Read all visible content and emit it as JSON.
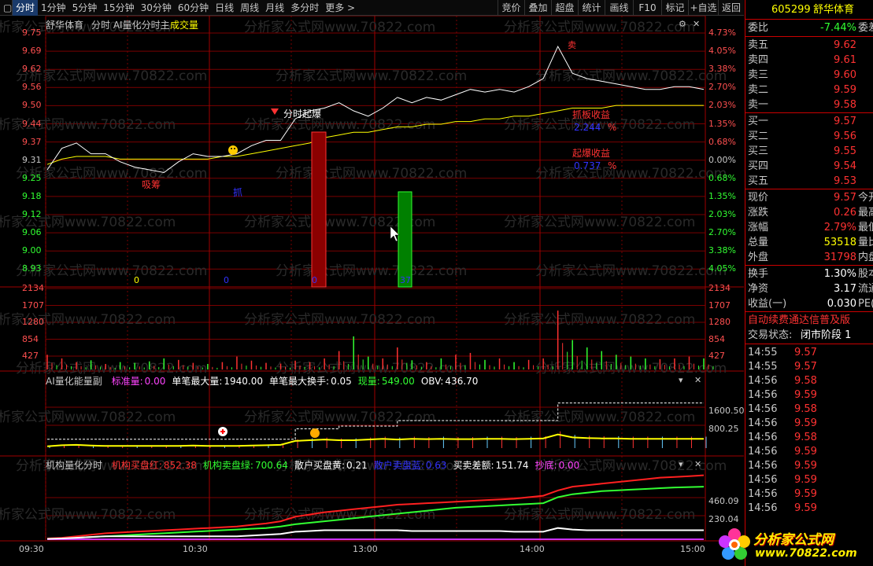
{
  "toolbar": {
    "tabs": [
      "分时",
      "1分钟",
      "5分钟",
      "15分钟",
      "30分钟",
      "60分钟",
      "日线",
      "周线",
      "月线",
      "多分时",
      "更多 >"
    ],
    "right_buttons": [
      "竞价",
      "叠加",
      "超盘",
      "统计",
      "画线",
      "F10",
      "标记",
      "+自选",
      "返回"
    ]
  },
  "main_panel": {
    "title": "舒华体育",
    "subtitle": "分时 AI量化分时主",
    "subtitle2": "成交量",
    "y_left": [
      "9.75",
      "9.69",
      "9.62",
      "9.56",
      "9.50",
      "9.44",
      "9.37",
      "9.31",
      "9.25",
      "9.18",
      "9.12",
      "9.06",
      "9.00",
      "8.93"
    ],
    "y_right": [
      "4.73%",
      "4.05%",
      "3.38%",
      "2.70%",
      "2.03%",
      "1.35%",
      "0.68%",
      "0.00%",
      "0.68%",
      "1.35%",
      "2.03%",
      "2.70%",
      "3.38%",
      "4.05%"
    ],
    "annotations": {
      "xichou": "吸筹",
      "dip": "抓",
      "fenshiqibao": "分时起爆",
      "zhaban_label": "抓板收益",
      "zhaban_value": "2.244",
      "qibao_label": "起爆收益",
      "qibao_value": "0.737",
      "pct": "%",
      "top_mark": "卖",
      "zero_a": "0",
      "zero_b": "0",
      "bar_label_a": "0",
      "bar_label_b": "37"
    }
  },
  "volume_panel": {
    "y": [
      "2134",
      "1707",
      "1280",
      "854",
      "427"
    ]
  },
  "ai_panel": {
    "title": "AI量化能量副",
    "items": [
      {
        "label": "标准量:",
        "value": "0.00",
        "color": "#ff44ff"
      },
      {
        "label": "单笔最大量:",
        "value": "1940.00",
        "color": "#ffffff"
      },
      {
        "label": "单笔最大换手:",
        "value": "0.05",
        "color": "#ffffff"
      },
      {
        "label": "现量:",
        "value": "549.00",
        "color": "#32ff32"
      },
      {
        "label": "OBV:",
        "value": "436.70",
        "color": "#ffffff"
      }
    ],
    "y": [
      "1600.50",
      "800.25"
    ]
  },
  "inst_panel": {
    "title": "机构量化分时",
    "items": [
      {
        "label": "机构买盘红:",
        "value": "852.38",
        "color": "#ff3232"
      },
      {
        "label": "机构卖盘绿:",
        "value": "700.64",
        "color": "#32ff32"
      },
      {
        "label": "散户买盘黄:",
        "value": "0.21",
        "color": "#ffffff"
      },
      {
        "label": "散户卖盘蓝:",
        "value": "0.63",
        "color": "#3232ff"
      },
      {
        "label": "买卖差额:",
        "value": "151.74",
        "color": "#ffffff"
      },
      {
        "label": "抄底:",
        "value": "0.00",
        "color": "#ff44ff"
      }
    ],
    "y": [
      "460.09",
      "230.04"
    ]
  },
  "x_axis": [
    "09:30",
    "10:30",
    "13:00",
    "14:00",
    "15:00"
  ],
  "side": {
    "code": "605299",
    "name": "舒华体育",
    "weibi_label": "委比",
    "weibi_value": "-7.44%",
    "weicha_label": "委差",
    "asks": [
      {
        "label": "卖五",
        "price": "9.62"
      },
      {
        "label": "卖四",
        "price": "9.61"
      },
      {
        "label": "卖三",
        "price": "9.60"
      },
      {
        "label": "卖二",
        "price": "9.59"
      },
      {
        "label": "卖一",
        "price": "9.58"
      }
    ],
    "bids": [
      {
        "label": "买一",
        "price": "9.57"
      },
      {
        "label": "买二",
        "price": "9.56"
      },
      {
        "label": "买三",
        "price": "9.55"
      },
      {
        "label": "买四",
        "price": "9.54"
      },
      {
        "label": "买五",
        "price": "9.53"
      }
    ],
    "stats": [
      {
        "label": "现价",
        "value": "9.57",
        "right": "今开",
        "color": "#ff3232"
      },
      {
        "label": "涨跌",
        "value": "0.26",
        "right": "最高",
        "color": "#ff3232"
      },
      {
        "label": "涨幅",
        "value": "2.79%",
        "right": "最低",
        "color": "#ff3232"
      },
      {
        "label": "总量",
        "value": "53518",
        "right": "量比",
        "color": "#ffff00"
      },
      {
        "label": "外盘",
        "value": "31798",
        "right": "内盘",
        "color": "#ff3232"
      }
    ],
    "stats2": [
      {
        "label": "换手",
        "value": "1.30%",
        "right": "股本",
        "color": "#ffffff"
      },
      {
        "label": "净资",
        "value": "3.17",
        "right": "流通",
        "color": "#ffffff"
      },
      {
        "label": "收益(一)",
        "value": "0.030",
        "right": "PE(动",
        "color": "#ffffff"
      }
    ],
    "notice": "自动续费通达信普及版",
    "status_label": "交易状态:",
    "status_value": "闭市阶段 1",
    "ticks": [
      {
        "t": "14:55",
        "p": "9.57"
      },
      {
        "t": "14:55",
        "p": "9.57"
      },
      {
        "t": "14:56",
        "p": "9.58"
      },
      {
        "t": "14:56",
        "p": "9.59"
      },
      {
        "t": "14:56",
        "p": "9.58"
      },
      {
        "t": "14:56",
        "p": "9.59"
      },
      {
        "t": "14:56",
        "p": "9.58"
      },
      {
        "t": "14:56",
        "p": "9.59"
      },
      {
        "t": "14:56",
        "p": "9.59"
      },
      {
        "t": "14:56",
        "p": "9.59"
      },
      {
        "t": "14:56",
        "p": "9.59"
      },
      {
        "t": "14:56",
        "p": "9.59"
      }
    ]
  },
  "watermark": "分析家公式网www.70822.com",
  "logo_text": "分析家公式网",
  "logo_url": "www.70822.com",
  "chart_data": {
    "type": "line",
    "price": {
      "prev_close": 9.31,
      "ylim": [
        8.9,
        9.78
      ],
      "x": [
        "09:30",
        "10:30",
        "11:30/13:00",
        "14:00",
        "15:00"
      ],
      "price_series": [
        9.27,
        9.35,
        9.37,
        9.33,
        9.33,
        9.3,
        9.28,
        9.27,
        9.26,
        9.3,
        9.33,
        9.32,
        9.32,
        9.33,
        9.36,
        9.38,
        9.38,
        9.46,
        9.49,
        9.5,
        9.52,
        9.49,
        9.47,
        9.5,
        9.54,
        9.52,
        9.54,
        9.53,
        9.55,
        9.57,
        9.56,
        9.57,
        9.56,
        9.58,
        9.61,
        9.73,
        9.63,
        9.61,
        9.6,
        9.59,
        9.58,
        9.57,
        9.57,
        9.58,
        9.58,
        9.57
      ],
      "avg_series": [
        9.29,
        9.31,
        9.32,
        9.32,
        9.32,
        9.31,
        9.31,
        9.31,
        9.31,
        9.31,
        9.31,
        9.31,
        9.32,
        9.32,
        9.33,
        9.34,
        9.35,
        9.36,
        9.37,
        9.39,
        9.4,
        9.41,
        9.41,
        9.42,
        9.43,
        9.43,
        9.44,
        9.44,
        9.45,
        9.45,
        9.46,
        9.46,
        9.47,
        9.47,
        9.48,
        9.49,
        9.5,
        9.5,
        9.5,
        9.51,
        9.51,
        9.51,
        9.51,
        9.51,
        9.51,
        9.51
      ]
    },
    "volume": {
      "ylim": [
        0,
        2200
      ],
      "values": [
        400,
        300,
        200,
        250,
        150,
        200,
        180,
        220,
        300,
        260,
        180,
        150,
        200,
        350,
        240,
        180,
        160,
        240,
        200,
        300,
        500,
        900,
        350,
        300,
        600,
        250,
        200,
        300,
        400,
        450,
        260,
        300,
        200,
        260,
        300,
        1600,
        800,
        600,
        500,
        400,
        350,
        300,
        280,
        300,
        350,
        300
      ]
    },
    "ai": {
      "ylim": [
        0,
        2000
      ],
      "steps": [
        320,
        320,
        320,
        320,
        320,
        320,
        320,
        320,
        320,
        320,
        320,
        320,
        320,
        320,
        320,
        320,
        320,
        700,
        700,
        700,
        800,
        800,
        800,
        800,
        1000,
        1000,
        1000,
        1000,
        1000,
        1000,
        1000,
        1000,
        1000,
        1000,
        1000,
        1640,
        1640,
        1640,
        1640,
        1640,
        1640,
        1640,
        1640,
        1640,
        1640,
        1640
      ],
      "obv": [
        50,
        80,
        90,
        70,
        60,
        60,
        60,
        60,
        60,
        60,
        70,
        60,
        60,
        60,
        70,
        80,
        90,
        200,
        220,
        240,
        220,
        220,
        240,
        260,
        240,
        260,
        250,
        260,
        250,
        250,
        260,
        260,
        250,
        260,
        270,
        380,
        300,
        280,
        270,
        270,
        260,
        260,
        260,
        260,
        260,
        260
      ]
    },
    "inst": {
      "ylim": [
        0,
        900
      ],
      "red": [
        10,
        20,
        40,
        60,
        80,
        90,
        100,
        110,
        120,
        130,
        140,
        150,
        160,
        170,
        190,
        210,
        240,
        300,
        330,
        360,
        380,
        400,
        420,
        440,
        460,
        470,
        480,
        490,
        500,
        510,
        520,
        530,
        540,
        560,
        580,
        650,
        700,
        720,
        740,
        760,
        780,
        800,
        820,
        830,
        840,
        852
      ],
      "green": [
        10,
        15,
        20,
        30,
        40,
        50,
        60,
        70,
        80,
        90,
        100,
        110,
        120,
        130,
        140,
        150,
        170,
        200,
        220,
        240,
        260,
        280,
        300,
        320,
        340,
        360,
        380,
        400,
        420,
        430,
        440,
        450,
        460,
        470,
        480,
        560,
        600,
        620,
        640,
        650,
        660,
        670,
        680,
        690,
        695,
        700
      ],
      "white": [
        5,
        10,
        20,
        30,
        40,
        40,
        40,
        40,
        40,
        40,
        40,
        40,
        40,
        40,
        50,
        60,
        70,
        100,
        110,
        120,
        120,
        120,
        120,
        120,
        120,
        110,
        110,
        110,
        110,
        110,
        110,
        110,
        100,
        100,
        100,
        150,
        130,
        120,
        120,
        120,
        120,
        120,
        120,
        120,
        120,
        120
      ],
      "purple": [
        0,
        0,
        0,
        0,
        0,
        0,
        0,
        0,
        0,
        0,
        0,
        0,
        0,
        0,
        0,
        0,
        0,
        0,
        0,
        0,
        0,
        0,
        0,
        0,
        0,
        0,
        0,
        0,
        0,
        0,
        0,
        0,
        0,
        0,
        0,
        0,
        0,
        0,
        0,
        0,
        0,
        0,
        0,
        0,
        0,
        0
      ]
    }
  }
}
